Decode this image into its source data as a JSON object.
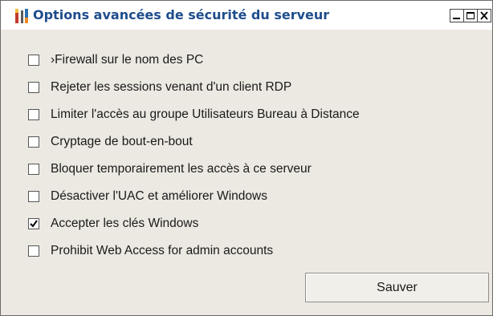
{
  "window": {
    "title": "Options avancées de sécurité du serveur",
    "app_icon": "tools-icon",
    "controls": {
      "minimize": "minimize-icon",
      "maximize": "maximize-icon",
      "close": "close-icon"
    },
    "title_color": "#1f4d8c"
  },
  "options": [
    {
      "label": "›Firewall sur le nom des PC",
      "checked": false
    },
    {
      "label": "Rejeter les sessions venant d'un client RDP",
      "checked": false
    },
    {
      "label": "Limiter l'accès au groupe Utilisateurs Bureau à Distance",
      "checked": false
    },
    {
      "label": "Cryptage de bout-en-bout",
      "checked": false
    },
    {
      "label": "Bloquer temporairement les accès à ce serveur",
      "checked": false
    },
    {
      "label": "Désactiver l'UAC et améliorer Windows",
      "checked": false
    },
    {
      "label": "Accepter les clés Windows",
      "checked": true
    },
    {
      "label": "Prohibit Web Access for admin accounts",
      "checked": false
    }
  ],
  "actions": {
    "save_label": "Sauver"
  }
}
